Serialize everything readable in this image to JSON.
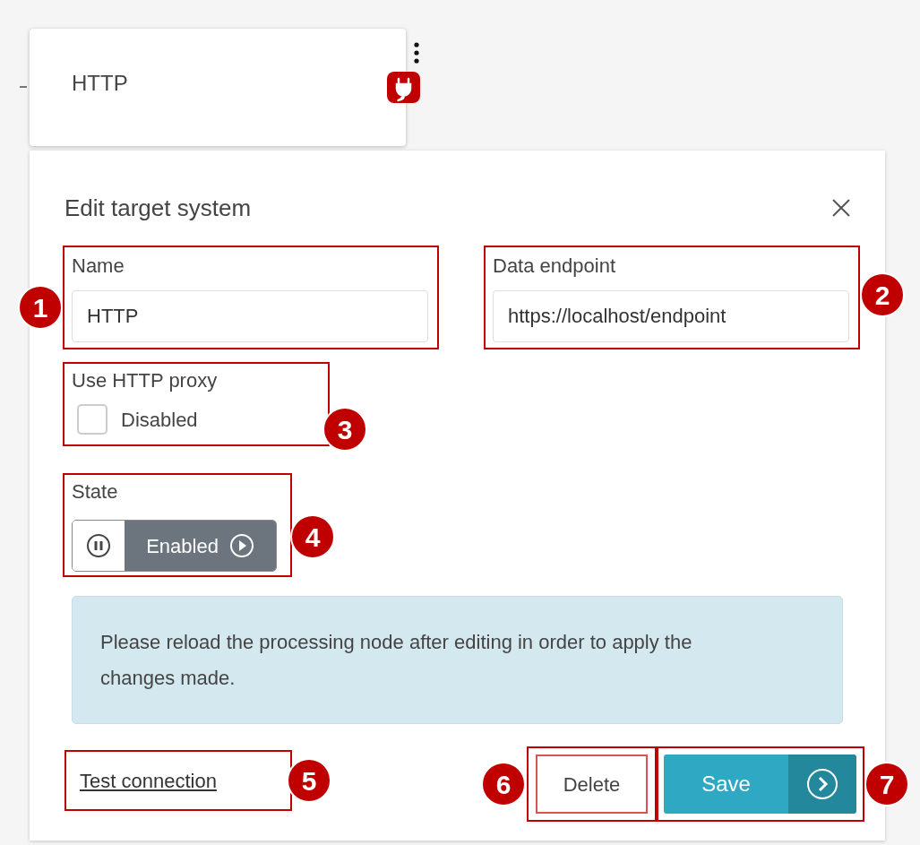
{
  "node_card": {
    "title": "HTTP"
  },
  "dialog": {
    "title": "Edit target system",
    "fields": [
      {
        "label": "Name",
        "value": "HTTP",
        "marker": "1"
      },
      {
        "label": "Data endpoint",
        "value": "https://localhost/endpoint",
        "marker": "2"
      }
    ],
    "proxy": {
      "label": "Use HTTP proxy",
      "checked": false,
      "option": "Disabled",
      "marker": "3"
    },
    "state": {
      "label": "State",
      "on": true,
      "value": "Enabled",
      "marker": "4"
    },
    "notice": "Please reload the processing node after editing in order to apply the changes made.",
    "test_link": {
      "label": "Test connection",
      "marker": "5"
    },
    "delete_button": {
      "label": "Delete",
      "marker": "6"
    },
    "save_button": {
      "label": "Save",
      "marker": "7"
    }
  }
}
